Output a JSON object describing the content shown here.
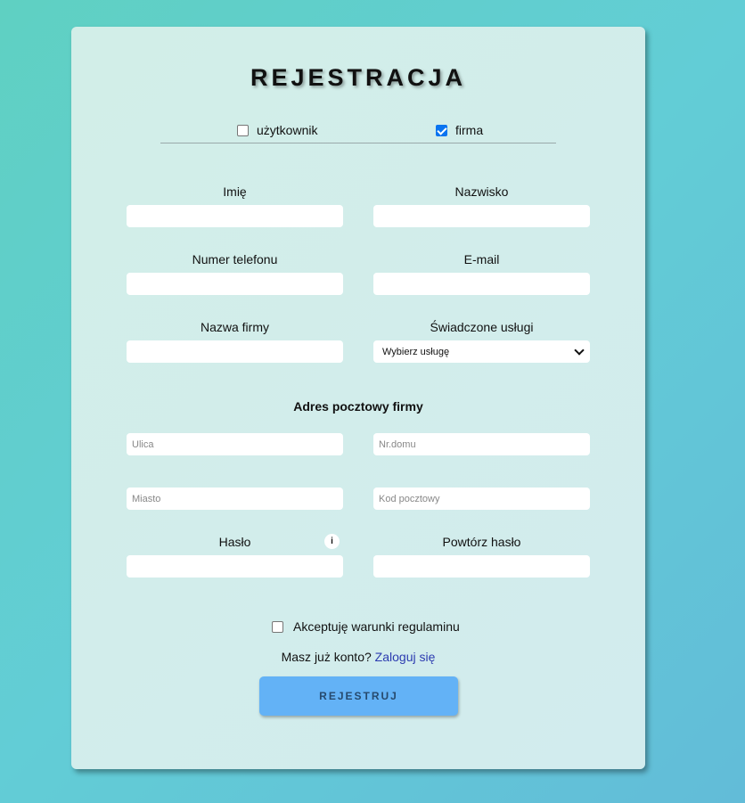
{
  "title": "REJESTRACJA",
  "account_type": {
    "user_label": "użytkownik",
    "user_checked": false,
    "company_label": "firma",
    "company_checked": true
  },
  "fields": {
    "first_name_label": "Imię",
    "last_name_label": "Nazwisko",
    "phone_label": "Numer telefonu",
    "email_label": "E-mail",
    "company_name_label": "Nazwa firmy",
    "services_label": "Świadczone usługi",
    "services_selected": "Wybierz usługę"
  },
  "address": {
    "section_title": "Adres pocztowy firmy",
    "street_placeholder": "Ulica",
    "house_no_placeholder": "Nr.domu",
    "city_placeholder": "Miasto",
    "postal_code_placeholder": "Kod pocztowy"
  },
  "password": {
    "password_label": "Hasło",
    "info_icon_text": "i",
    "repeat_label": "Powtórz hasło"
  },
  "terms": {
    "label": "Akceptuję warunki regulaminu",
    "checked": false
  },
  "login": {
    "prompt": "Masz już konto?",
    "link_text": "Zaloguj się"
  },
  "submit_label": "REJESTRUJ",
  "colors": {
    "accent_button": "#63b2f6",
    "link": "#2c3bb0",
    "checkbox_checked": "#0a74f0"
  }
}
